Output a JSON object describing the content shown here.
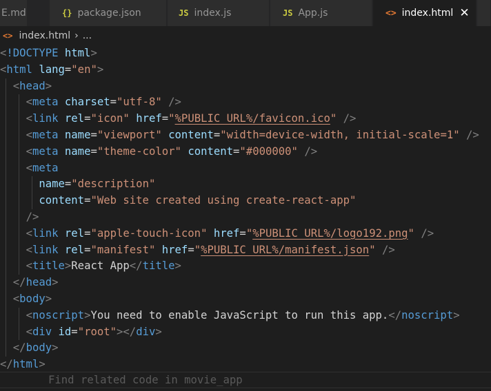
{
  "tabs": [
    {
      "label": "E.md",
      "icon": "markdown-icon",
      "glyph": "",
      "active": false
    },
    {
      "label": "package.json",
      "icon": "json-file-icon",
      "glyph": "{}",
      "active": false
    },
    {
      "label": "index.js",
      "icon": "js-file-icon",
      "glyph": "JS",
      "active": false
    },
    {
      "label": "App.js",
      "icon": "js-file-icon",
      "glyph": "JS",
      "active": false
    },
    {
      "label": "index.html",
      "icon": "html-file-icon",
      "glyph": "<>",
      "active": true
    }
  ],
  "close_glyph": "✕",
  "breadcrumb": {
    "glyph": "<>",
    "file": "index.html",
    "sep": "›",
    "more": "..."
  },
  "hint": "Find related code in movie_app",
  "colors": {
    "background": "#1e1e1e",
    "tag_bracket": "#808080",
    "tag_name": "#569cd6",
    "attribute": "#9cdcfe",
    "string": "#ce9178",
    "text": "#d4d4d4"
  },
  "code_lines": [
    {
      "guides": 0,
      "tokens": [
        [
          "t",
          "<"
        ],
        [
          "n",
          "!DOCTYPE"
        ],
        [
          "x",
          " "
        ],
        [
          "a",
          "html"
        ],
        [
          "t",
          ">"
        ]
      ]
    },
    {
      "guides": 0,
      "tokens": [
        [
          "t",
          "<"
        ],
        [
          "n",
          "html"
        ],
        [
          "x",
          " "
        ],
        [
          "a",
          "lang"
        ],
        [
          "x",
          "="
        ],
        [
          "v",
          "\"en\""
        ],
        [
          "t",
          ">"
        ]
      ]
    },
    {
      "guides": 1,
      "tokens": [
        [
          "x",
          "  "
        ],
        [
          "t",
          "<"
        ],
        [
          "n",
          "head"
        ],
        [
          "t",
          ">"
        ]
      ]
    },
    {
      "guides": 2,
      "tokens": [
        [
          "x",
          "    "
        ],
        [
          "t",
          "<"
        ],
        [
          "n",
          "meta"
        ],
        [
          "x",
          " "
        ],
        [
          "a",
          "charset"
        ],
        [
          "x",
          "="
        ],
        [
          "v",
          "\"utf-8\""
        ],
        [
          "x",
          " "
        ],
        [
          "t",
          "/>"
        ]
      ]
    },
    {
      "guides": 2,
      "tokens": [
        [
          "x",
          "    "
        ],
        [
          "t",
          "<"
        ],
        [
          "n",
          "link"
        ],
        [
          "x",
          " "
        ],
        [
          "a",
          "rel"
        ],
        [
          "x",
          "="
        ],
        [
          "v",
          "\"icon\""
        ],
        [
          "x",
          " "
        ],
        [
          "a",
          "href"
        ],
        [
          "x",
          "="
        ],
        [
          "v",
          "\""
        ],
        [
          "vu",
          "%PUBLIC_URL%/favicon.ico"
        ],
        [
          "v",
          "\""
        ],
        [
          "x",
          " "
        ],
        [
          "t",
          "/>"
        ]
      ]
    },
    {
      "guides": 2,
      "tokens": [
        [
          "x",
          "    "
        ],
        [
          "t",
          "<"
        ],
        [
          "n",
          "meta"
        ],
        [
          "x",
          " "
        ],
        [
          "a",
          "name"
        ],
        [
          "x",
          "="
        ],
        [
          "v",
          "\"viewport\""
        ],
        [
          "x",
          " "
        ],
        [
          "a",
          "content"
        ],
        [
          "x",
          "="
        ],
        [
          "v",
          "\"width=device-width, initial-scale=1\""
        ],
        [
          "x",
          " "
        ],
        [
          "t",
          "/>"
        ]
      ]
    },
    {
      "guides": 2,
      "tokens": [
        [
          "x",
          "    "
        ],
        [
          "t",
          "<"
        ],
        [
          "n",
          "meta"
        ],
        [
          "x",
          " "
        ],
        [
          "a",
          "name"
        ],
        [
          "x",
          "="
        ],
        [
          "v",
          "\"theme-color\""
        ],
        [
          "x",
          " "
        ],
        [
          "a",
          "content"
        ],
        [
          "x",
          "="
        ],
        [
          "v",
          "\"#000000\""
        ],
        [
          "x",
          " "
        ],
        [
          "t",
          "/>"
        ]
      ]
    },
    {
      "guides": 2,
      "tokens": [
        [
          "x",
          "    "
        ],
        [
          "t",
          "<"
        ],
        [
          "n",
          "meta"
        ]
      ]
    },
    {
      "guides": 3,
      "tokens": [
        [
          "x",
          "      "
        ],
        [
          "a",
          "name"
        ],
        [
          "x",
          "="
        ],
        [
          "v",
          "\"description\""
        ]
      ]
    },
    {
      "guides": 3,
      "tokens": [
        [
          "x",
          "      "
        ],
        [
          "a",
          "content"
        ],
        [
          "x",
          "="
        ],
        [
          "v",
          "\"Web site created using create-react-app\""
        ]
      ]
    },
    {
      "guides": 2,
      "tokens": [
        [
          "x",
          "    "
        ],
        [
          "t",
          "/>"
        ]
      ]
    },
    {
      "guides": 2,
      "tokens": [
        [
          "x",
          "    "
        ],
        [
          "t",
          "<"
        ],
        [
          "n",
          "link"
        ],
        [
          "x",
          " "
        ],
        [
          "a",
          "rel"
        ],
        [
          "x",
          "="
        ],
        [
          "v",
          "\"apple-touch-icon\""
        ],
        [
          "x",
          " "
        ],
        [
          "a",
          "href"
        ],
        [
          "x",
          "="
        ],
        [
          "v",
          "\""
        ],
        [
          "vu",
          "%PUBLIC_URL%/logo192.png"
        ],
        [
          "v",
          "\""
        ],
        [
          "x",
          " "
        ],
        [
          "t",
          "/>"
        ]
      ]
    },
    {
      "guides": 2,
      "tokens": [
        [
          "x",
          "    "
        ],
        [
          "t",
          "<"
        ],
        [
          "n",
          "link"
        ],
        [
          "x",
          " "
        ],
        [
          "a",
          "rel"
        ],
        [
          "x",
          "="
        ],
        [
          "v",
          "\"manifest\""
        ],
        [
          "x",
          " "
        ],
        [
          "a",
          "href"
        ],
        [
          "x",
          "="
        ],
        [
          "v",
          "\""
        ],
        [
          "vu",
          "%PUBLIC_URL%/manifest.json"
        ],
        [
          "v",
          "\""
        ],
        [
          "x",
          " "
        ],
        [
          "t",
          "/>"
        ]
      ]
    },
    {
      "guides": 2,
      "tokens": [
        [
          "x",
          "    "
        ],
        [
          "t",
          "<"
        ],
        [
          "n",
          "title"
        ],
        [
          "t",
          ">"
        ],
        [
          "x",
          "React App"
        ],
        [
          "t",
          "</"
        ],
        [
          "n",
          "title"
        ],
        [
          "t",
          ">"
        ]
      ]
    },
    {
      "guides": 1,
      "tokens": [
        [
          "x",
          "  "
        ],
        [
          "t",
          "</"
        ],
        [
          "n",
          "head"
        ],
        [
          "t",
          ">"
        ]
      ]
    },
    {
      "guides": 1,
      "tokens": [
        [
          "x",
          "  "
        ],
        [
          "t",
          "<"
        ],
        [
          "n",
          "body"
        ],
        [
          "t",
          ">"
        ]
      ]
    },
    {
      "guides": 2,
      "tokens": [
        [
          "x",
          "    "
        ],
        [
          "t",
          "<"
        ],
        [
          "n",
          "noscript"
        ],
        [
          "t",
          ">"
        ],
        [
          "x",
          "You need to enable JavaScript to run this app."
        ],
        [
          "t",
          "</"
        ],
        [
          "n",
          "noscript"
        ],
        [
          "t",
          ">"
        ]
      ]
    },
    {
      "guides": 2,
      "tokens": [
        [
          "x",
          "    "
        ],
        [
          "t",
          "<"
        ],
        [
          "n",
          "div"
        ],
        [
          "x",
          " "
        ],
        [
          "a",
          "id"
        ],
        [
          "x",
          "="
        ],
        [
          "v",
          "\"root\""
        ],
        [
          "t",
          "></"
        ],
        [
          "n",
          "div"
        ],
        [
          "t",
          ">"
        ]
      ]
    },
    {
      "guides": 1,
      "tokens": [
        [
          "x",
          "  "
        ],
        [
          "t",
          "</"
        ],
        [
          "n",
          "body"
        ],
        [
          "t",
          ">"
        ]
      ]
    },
    {
      "guides": 0,
      "tokens": [
        [
          "t",
          "</"
        ],
        [
          "n",
          "html"
        ],
        [
          "t",
          ">"
        ]
      ]
    }
  ]
}
